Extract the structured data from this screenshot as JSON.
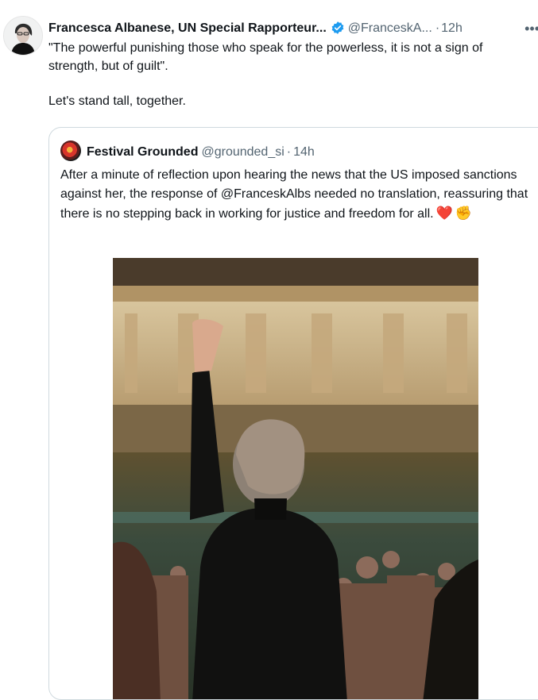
{
  "tweet": {
    "author": "Francesca Albanese, UN Special Rapporteur...",
    "handle": "@FranceskA...",
    "separator": "·",
    "time": "12h",
    "more_label": "•••",
    "text_line1": "\"The powerful punishing those who speak for the powerless, it is not a sign of strength, but of guilt\".",
    "text_line2": "Let's stand tall, together."
  },
  "quote": {
    "author": "Festival Grounded",
    "handle": "@grounded_si",
    "separator": "·",
    "time": "14h",
    "text": "After a minute of reflection upon hearing the news that the US imposed sanctions against her, the response of @FranceskAlbs needed no translation, reassuring that there is no stepping back in working for justice and freedom for all.",
    "emoji_heart": "❤️",
    "emoji_fist": "✊"
  },
  "colors": {
    "text": "#0f1419",
    "secondary": "#536471",
    "border": "#cfd9de",
    "verified": "#1d9bf0"
  },
  "icons": [
    "verified-badge-icon",
    "more-icon"
  ]
}
